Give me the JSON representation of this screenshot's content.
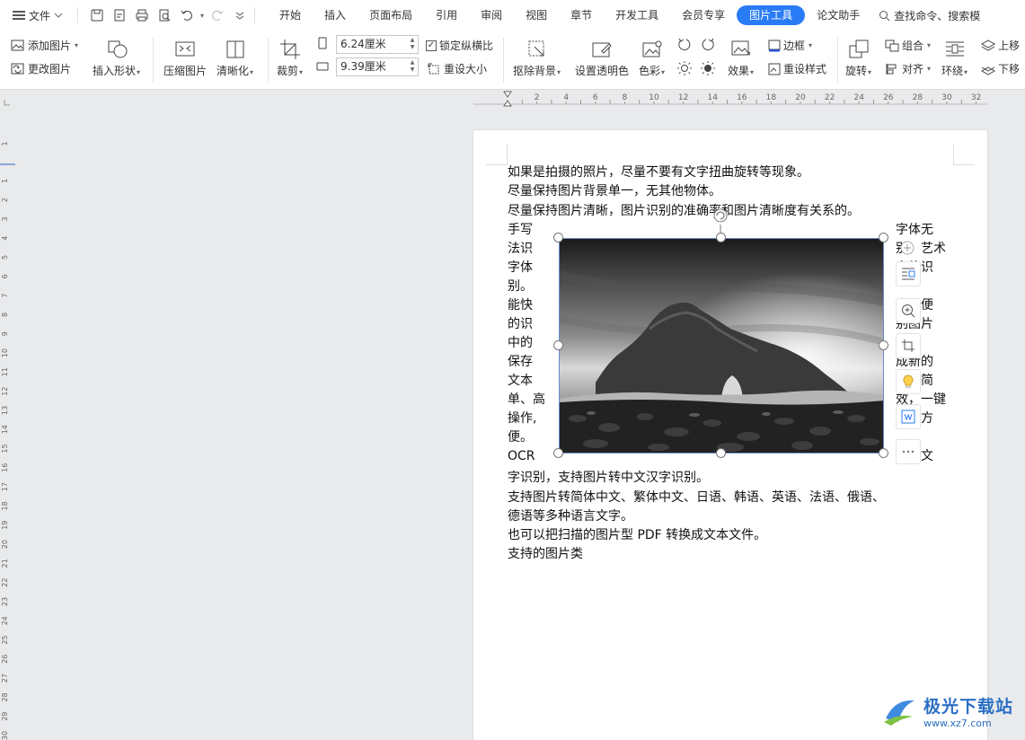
{
  "menubar": {
    "file_label": "文件",
    "tabs": [
      "开始",
      "插入",
      "页面布局",
      "引用",
      "审阅",
      "视图",
      "章节",
      "开发工具",
      "会员专享",
      "图片工具",
      "论文助手"
    ],
    "active_tab": "图片工具",
    "search_label": "查找命令、搜索模"
  },
  "ribbon": {
    "add_picture": "添加图片",
    "change_picture": "更改图片",
    "insert_shape": "插入形状",
    "compress_picture": "压缩图片",
    "sharpen": "清晰化",
    "crop": "裁剪",
    "height_value": "6.24厘米",
    "width_value": "9.39厘米",
    "lock_ratio": "锁定纵横比",
    "reset_size": "重设大小",
    "remove_background": "抠除背景",
    "set_transparent": "设置透明色",
    "color": "色彩",
    "effects": "效果",
    "border": "边框",
    "reset_style": "重设样式",
    "rotate": "旋转",
    "group": "组合",
    "align": "对齐",
    "wrap": "环绕",
    "bring_forward": "上移",
    "send_backward": "下移"
  },
  "ruler": {
    "h_ticks": [
      "2",
      "4",
      "6",
      "8",
      "10",
      "12",
      "14",
      "16",
      "18",
      "20",
      "22",
      "24",
      "26",
      "28",
      "30",
      "32"
    ],
    "v_ticks": [
      "1",
      "1",
      "2",
      "3",
      "4",
      "5",
      "6",
      "7",
      "8",
      "9",
      "10",
      "11",
      "12",
      "13",
      "14",
      "15",
      "16",
      "17",
      "18",
      "19",
      "20",
      "21",
      "22",
      "23",
      "24",
      "25",
      "26",
      "27",
      "28",
      "29",
      "30"
    ]
  },
  "document": {
    "line1": "如果是拍摄的照片，尽量不要有文字扭曲旋转等现象。",
    "line2": "尽量保持图片背景单一，无其他物体。",
    "line3": "尽量保持图片清晰，图片识别的准确率和图片清晰度有关系的。",
    "left_col": [
      "手写",
      "法识",
      "字体",
      "别。",
      "能快",
      "的识",
      "中的",
      "保存",
      "文本",
      "单、高",
      "操作,",
      "便。",
      "OCR"
    ],
    "right_col": [
      "字体无",
      "别，艺术",
      "字体识",
      "",
      "中方便",
      "别图片",
      "字并",
      "成新的",
      "件，简",
      "效，一键",
      "捷、方",
      "",
      "图片文"
    ],
    "line_after1": "字识别，支持图片转中文汉字识别。",
    "line_after2": "支持图片转简体中文、繁体中文、日语、韩语、英语、法语、俄语、",
    "line_after3": "德语等多种语言文字。",
    "line_after4": "也可以把扫描的图片型 PDF 转换成文本文件。",
    "line_after5": "支持的图片类"
  },
  "watermark": {
    "brand": "极光下载站",
    "url": "www.xz7.com"
  },
  "colors": {
    "accent": "#2a7cf6",
    "page_bg": "#e9eaec"
  }
}
